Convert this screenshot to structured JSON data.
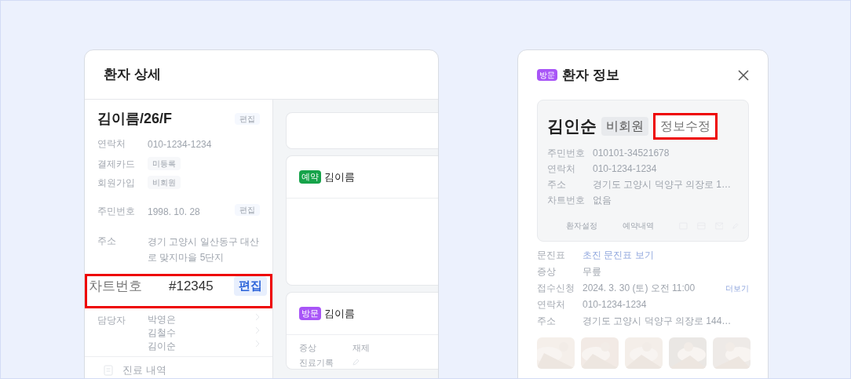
{
  "patient_detail": {
    "title": "환자 상세",
    "heading": "김이름/26/F",
    "heading_action": "편집",
    "fields": [
      {
        "label": "연락처",
        "value": "010-1234-1234",
        "highlighted": false
      },
      {
        "label": "결제카드",
        "value": "미등록",
        "kind": "chip",
        "highlighted": false
      },
      {
        "label": "회원가입",
        "value": "비회원",
        "kind": "chip",
        "highlighted": false
      },
      {
        "label": "주민번호",
        "value": "1998. 10. 28",
        "action": "편집",
        "highlighted": false
      },
      {
        "label": "주소",
        "value": "경기 고양시 일산동구 대산로 맞지마을 5단지",
        "highlighted": false
      },
      {
        "label": "차트번호",
        "value": "#12345",
        "action": "편집",
        "highlighted": true
      }
    ],
    "staff": {
      "label": "담당자",
      "members": [
        "박영은",
        "김철수",
        "김이순"
      ]
    },
    "menu_item": "진료 내역"
  },
  "timeline": {
    "cards": [
      {
        "tag": "예약",
        "color": "#16a34a",
        "name": "김이름"
      },
      {
        "tag": "방문",
        "color": "#a855f7",
        "name": "김이름",
        "fields": [
          {
            "label": "증상",
            "value": "재제"
          },
          {
            "label": "진료기록",
            "kind": "pencil"
          }
        ]
      }
    ]
  },
  "patient_info": {
    "tag": "방문",
    "title": "환자 정보",
    "name": "김인순",
    "membership": "비회원",
    "edit_button": "정보수정",
    "edit_highlighted": true,
    "fields": [
      {
        "label": "주민번호",
        "value": "010101-34521678"
      },
      {
        "label": "연락처",
        "value": "010-1234-1234"
      },
      {
        "label": "주소",
        "value": "경기도 고양시 덕양구 의장로 1…"
      },
      {
        "label": "차트번호",
        "value": "없음"
      }
    ],
    "links": [
      "환자설정",
      "예약내역"
    ],
    "details": [
      {
        "label": "문진표",
        "value": "초진 문진표 보기",
        "kind": "link"
      },
      {
        "label": "증상",
        "value": "무릎"
      },
      {
        "label": "접수신청",
        "value": "2024. 3. 30 (토) 오전 11:00",
        "action": "더보기"
      },
      {
        "label": "연락처",
        "value": "010-1234-1234"
      },
      {
        "label": "주소",
        "value": "경기도 고양시 덕양구 의장로 144…"
      }
    ],
    "photos": [
      {
        "kind": "picture"
      },
      {
        "kind": "picture"
      },
      {
        "kind": "picture"
      },
      {
        "kind": "picture"
      },
      {
        "kind": "picture"
      }
    ]
  }
}
